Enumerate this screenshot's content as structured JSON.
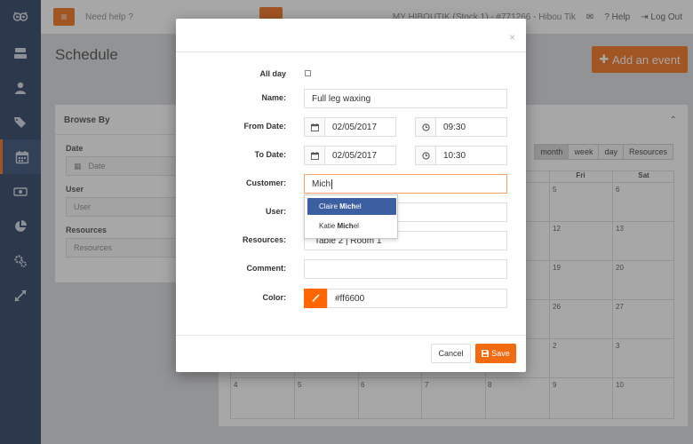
{
  "topbar": {
    "menu_icon": "hamburger-icon",
    "help_text": "Need help ?",
    "company": "MY HIBOUTIK (Stock 1) - #771266 - Hibou Tik",
    "help_label": "Help",
    "logout_label": "Log Out"
  },
  "sidebar": {
    "items": [
      {
        "icon": "register-icon"
      },
      {
        "icon": "user-icon"
      },
      {
        "icon": "tags-icon"
      },
      {
        "icon": "calendar-icon",
        "active": true
      },
      {
        "icon": "money-icon"
      },
      {
        "icon": "pie-chart-icon"
      },
      {
        "icon": "gears-icon"
      },
      {
        "icon": "expand-icon"
      }
    ]
  },
  "page": {
    "title": "Schedule",
    "add_event_label": "Add an event"
  },
  "browse": {
    "title": "Browse By",
    "date_label": "Date",
    "date_placeholder": "Date",
    "user_label": "User",
    "user_value": "User",
    "resources_label": "Resources",
    "resources_value": "Resources"
  },
  "calendar": {
    "views": [
      "month",
      "week",
      "day",
      "Resources"
    ],
    "active_view": "month",
    "day_headers": [
      "Fri",
      "Sat"
    ],
    "rows": [
      [
        "5",
        "6"
      ],
      [
        "12",
        "13"
      ],
      [
        "19",
        "20"
      ],
      [
        "26",
        "27"
      ],
      [
        "2",
        "3"
      ]
    ],
    "last_row": [
      "4",
      "5",
      "6",
      "7",
      "8",
      "9",
      "10"
    ]
  },
  "modal": {
    "close": "×",
    "all_day_label": "All day",
    "name_label": "Name:",
    "name_value": "Full leg waxing",
    "from_label": "From Date:",
    "from_date": "02/05/2017",
    "from_time": "09:30",
    "to_label": "To Date:",
    "to_date": "02/05/2017",
    "to_time": "10:30",
    "customer_label": "Customer:",
    "customer_value": "Mich",
    "user_label": "User:",
    "resources_label": "Resources:",
    "resources_value": "Table 2 | Room 1",
    "comment_label": "Comment:",
    "color_label": "Color:",
    "color_value": "#ff6600",
    "cancel_label": "Cancel",
    "save_label": "Save",
    "suggestions": [
      {
        "prefix": "Claire ",
        "match": "Mich",
        "suffix": "el",
        "active": true
      },
      {
        "prefix": "Katie ",
        "match": "Mich",
        "suffix": "el",
        "active": false
      }
    ]
  },
  "colors": {
    "accent": "#f26b10",
    "sidebar": "#1f3559",
    "highlight": "#3b5fa0",
    "swatch": "#ff6600"
  }
}
